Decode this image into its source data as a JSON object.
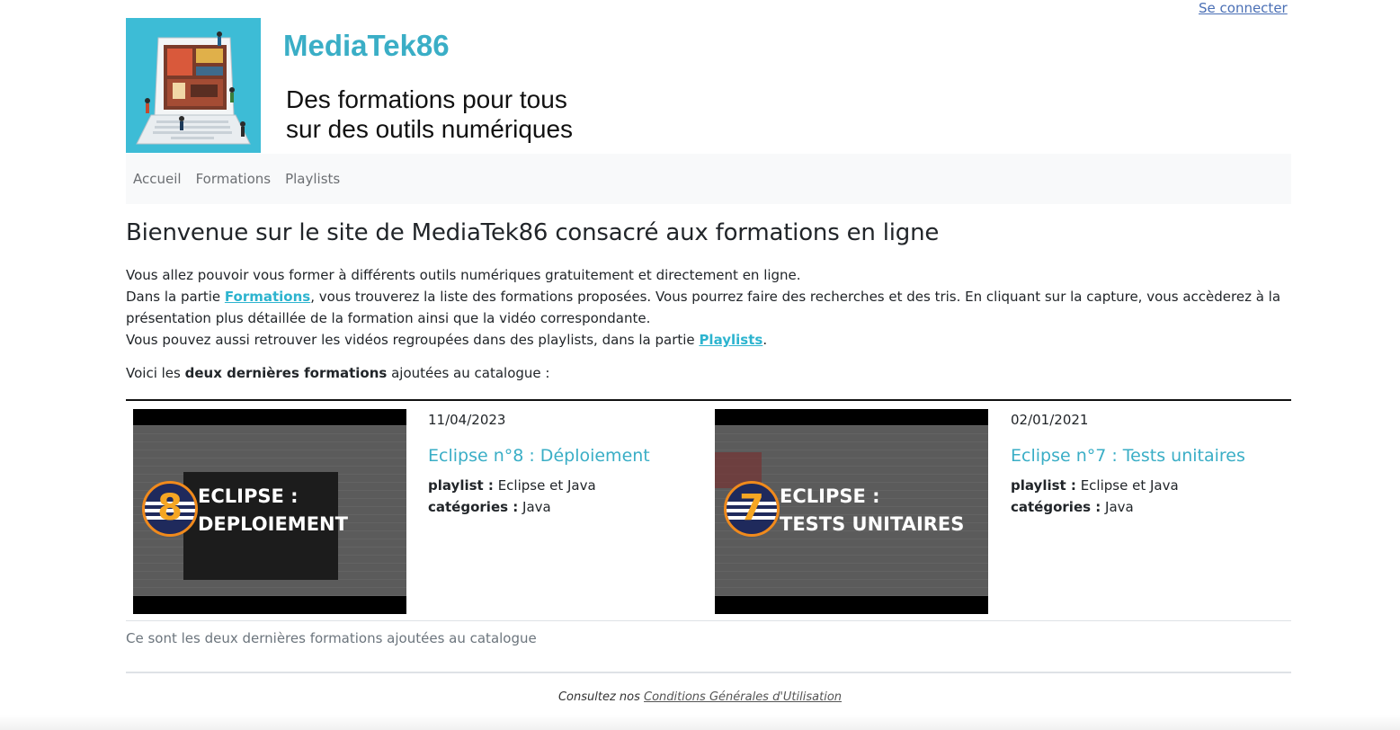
{
  "header": {
    "login_label": "Se connecter",
    "site_name": "MediaTek86",
    "tagline_line1": "Des formations pour tous",
    "tagline_line2": "sur des outils numériques"
  },
  "nav": {
    "items": [
      {
        "label": "Accueil"
      },
      {
        "label": "Formations"
      },
      {
        "label": "Playlists"
      }
    ]
  },
  "main": {
    "title": "Bienvenue sur le site de MediaTek86 consacré aux formations en ligne",
    "intro_line1": "Vous allez pouvoir vous former à différents outils numériques gratuitement et directement en ligne.",
    "intro_line2_before": "Dans la partie ",
    "intro_line2_link": "Formations",
    "intro_line2_after": ", vous trouverez la liste des formations proposées. Vous pourrez faire des recherches et des tris. En cliquant sur la capture, vous accèderez à la présentation plus détaillée de la formation ainsi que la vidéo correspondante.",
    "intro_line3_before": "Vous pouvez aussi retrouver les vidéos regroupées dans des playlists, dans la partie ",
    "intro_line3_link": "Playlists",
    "intro_line3_after": ".",
    "latest_before": "Voici les ",
    "latest_strong": "deux dernières formations",
    "latest_after": " ajoutées au catalogue :"
  },
  "formations": [
    {
      "date": "11/04/2023",
      "title": "Eclipse n°8 : Déploiement",
      "playlist_label": "playlist :",
      "playlist": "Eclipse et Java",
      "categories_label": "catégories :",
      "categories": "Java",
      "thumb_number": "8",
      "thumb_line1": "ECLIPSE :",
      "thumb_line2": "DEPLOIEMENT"
    },
    {
      "date": "02/01/2021",
      "title": "Eclipse n°7 : Tests unitaires",
      "playlist_label": "playlist :",
      "playlist": "Eclipse et Java",
      "categories_label": "catégories :",
      "categories": "Java",
      "thumb_number": "7",
      "thumb_line1": "ECLIPSE :",
      "thumb_line2": "TESTS UNITAIRES"
    }
  ],
  "caption": "Ce sont les deux dernières formations ajoutées au catalogue",
  "footer": {
    "prefix": "Consultez nos ",
    "link": "Conditions Générales d'Utilisation"
  },
  "colors": {
    "brand": "#3aaec6",
    "link": "#2db4cf",
    "banner_bg": "#3dbcd6",
    "nav_bg": "#f8f9fa"
  }
}
